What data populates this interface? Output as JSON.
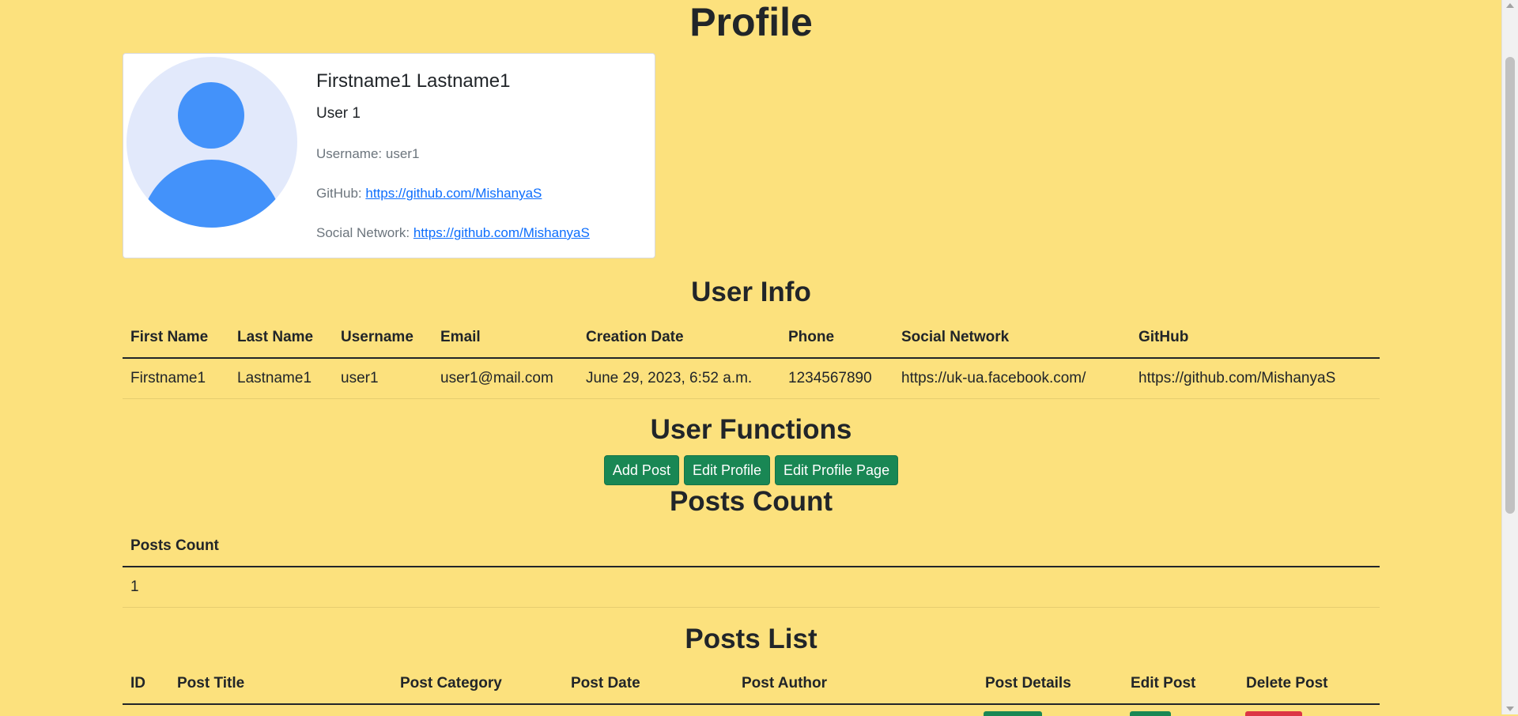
{
  "page": {
    "title": "Profile"
  },
  "profile_card": {
    "full_name": "Firstname1 Lastname1",
    "subtitle": "User 1",
    "username_label": "Username:",
    "username": "user1",
    "github_label": "GitHub:",
    "github_url": "https://github.com/MishanyaS",
    "social_label": "Social Network:",
    "social_url": "https://github.com/MishanyaS"
  },
  "user_info": {
    "heading": "User Info",
    "columns": [
      "First Name",
      "Last Name",
      "Username",
      "Email",
      "Creation Date",
      "Phone",
      "Social Network",
      "GitHub"
    ],
    "row": [
      "Firstname1",
      "Lastname1",
      "user1",
      "user1@mail.com",
      "June 29, 2023, 6:52 a.m.",
      "1234567890",
      "https://uk-ua.facebook.com/",
      "https://github.com/MishanyaS"
    ]
  },
  "user_functions": {
    "heading": "User Functions",
    "add_post": "Add Post",
    "edit_profile": "Edit Profile",
    "edit_profile_page": "Edit Profile Page"
  },
  "posts_count": {
    "heading": "Posts Count",
    "column": "Posts Count",
    "value": "1"
  },
  "posts_list": {
    "heading": "Posts List",
    "columns": [
      "ID",
      "Post Title",
      "Post Category",
      "Post Date",
      "Post Author",
      "Post Details",
      "Edit Post",
      "Delete Post"
    ]
  },
  "colors": {
    "background": "#fce17d",
    "button_green": "#198754",
    "button_red": "#dc3545",
    "link": "#0d6efd",
    "avatar_blue": "#4392fa"
  }
}
